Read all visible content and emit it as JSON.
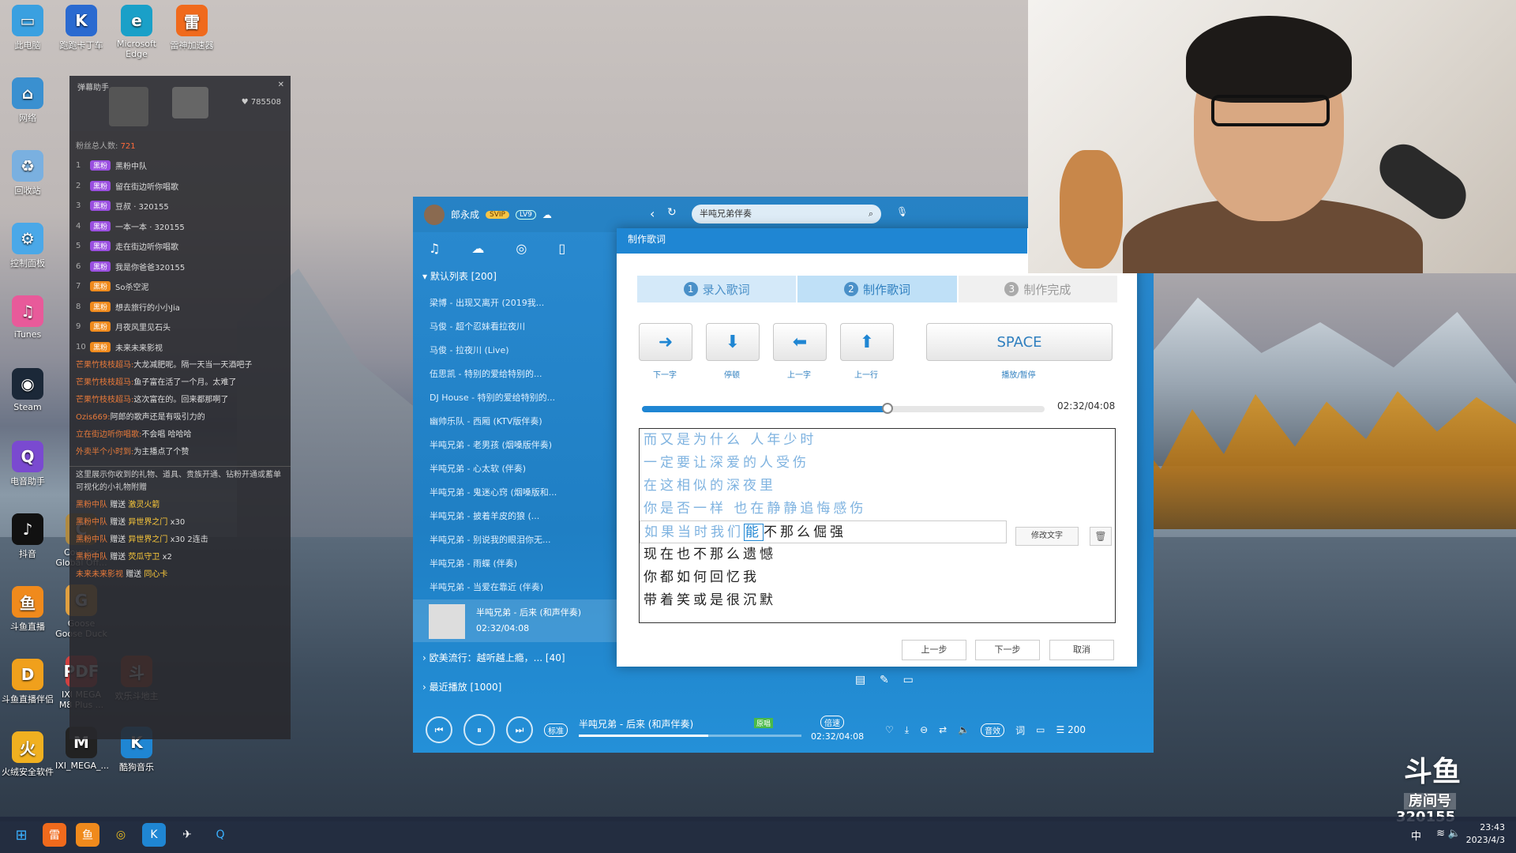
{
  "desktop": {
    "icons": [
      {
        "label": "此电脑",
        "glyph": "▭",
        "color": "#3aa0e0"
      },
      {
        "label": "网络",
        "glyph": "⌂",
        "color": "#3a90d0"
      },
      {
        "label": "回收站",
        "glyph": "♻",
        "color": "#7ab0e0"
      },
      {
        "label": "控制面板",
        "glyph": "⚙",
        "color": "#4aa8e8"
      },
      {
        "label": "iTunes",
        "glyph": "♫",
        "color": "#e85a9a"
      },
      {
        "label": "Steam",
        "glyph": "◉",
        "color": "#1b2838"
      },
      {
        "label": "电音助手",
        "glyph": "Q",
        "color": "#7a4ad0"
      },
      {
        "label": "抖音",
        "glyph": "♪",
        "color": "#111"
      },
      {
        "label": "斗鱼直播",
        "glyph": "鱼",
        "color": "#f08a1c"
      },
      {
        "label": "斗鱼直播伴侣",
        "glyph": "D",
        "color": "#f0a01c"
      },
      {
        "label": "火绒安全软件",
        "glyph": "火",
        "color": "#f0b020"
      }
    ],
    "icons_col2": [
      {
        "label": "跑跑卡丁车",
        "glyph": "K",
        "color": "#2a6ad0"
      },
      {
        "label": "Microsoft Edge",
        "glyph": "e",
        "color": "#1aa0c8"
      },
      {
        "label": "雷神加速器",
        "glyph": "雷",
        "color": "#f06a1c"
      },
      {
        "label": "IXI MEGA M8 Plus ...",
        "glyph": "PDF",
        "color": "#d04040"
      },
      {
        "label": "欢乐斗地主",
        "glyph": "斗",
        "color": "#c04a2a"
      },
      {
        "label": "IXI_MEGA_...",
        "glyph": "M",
        "color": "#222"
      },
      {
        "label": "酷狗音乐",
        "glyph": "K",
        "color": "#1f86d3"
      },
      {
        "label": "Counter Global Off...",
        "glyph": "C",
        "color": "#b08a40"
      },
      {
        "label": "Goose Goose Duck",
        "glyph": "G",
        "color": "#e0a040"
      }
    ]
  },
  "chat": {
    "title": "弹幕助手",
    "stat": "785508",
    "fans_label": "粉丝总人数:",
    "fans_count": "721",
    "badge": "黑粉",
    "ranks": [
      {
        "no": "1",
        "name": "黑粉中队"
      },
      {
        "no": "2",
        "name": "留在街边听你唱歌"
      },
      {
        "no": "3",
        "name": "豆叔 · 320155"
      },
      {
        "no": "4",
        "name": "一本一本 · 320155"
      },
      {
        "no": "5",
        "name": "走在街边听你唱歌"
      },
      {
        "no": "6",
        "name": "我是你爸爸320155"
      },
      {
        "no": "7",
        "name": "So杀空泥"
      },
      {
        "no": "8",
        "name": "想去旅行的小小Jia"
      },
      {
        "no": "9",
        "name": "月夜风里见石头"
      },
      {
        "no": "10",
        "name": "未来未来影视"
      }
    ],
    "messages": [
      {
        "who": "芒果竹枝枝超马:",
        "text": "大龙减肥呢。隔一天当一天酒吧子"
      },
      {
        "who": "芒果竹枝枝超马:",
        "text": "鱼子富在活了一个月。太难了"
      },
      {
        "who": "芒果竹枝枝超马:",
        "text": "这次富在的。回来都那啊了"
      },
      {
        "who": "Ozis669:",
        "text": "阿郎的歌声还是有吸引力的"
      },
      {
        "who": "立在街边听你唱歌:",
        "text": "不会唱 哈哈哈"
      },
      {
        "who": "外卖半个小时到:",
        "text": "为主播点了个赞"
      }
    ],
    "notice": "这里展示你收到的礼物、道具、贵族开通、钻粉开通或蓄单可视化的小礼物附赠",
    "gifts": [
      {
        "who": "黑粉中队",
        "verb": "赠送",
        "item": "激灵火箭",
        "count": ""
      },
      {
        "who": "黑粉中队",
        "verb": "赠送",
        "item": "异世界之门",
        "count": "x30"
      },
      {
        "who": "黑粉中队",
        "verb": "赠送",
        "item": "异世界之门",
        "count": "x30 2连击"
      },
      {
        "who": "黑粉中队",
        "verb": "赠送",
        "item": "荧瓜守卫",
        "count": "x2"
      },
      {
        "who": "未来未来影视",
        "verb": "赠送",
        "item": "同心卡",
        "count": ""
      }
    ]
  },
  "player": {
    "username": "郎永成",
    "svip": "SVIP",
    "level": "LV9",
    "search_value": "半吨兄弟伴奏",
    "nav_icons": [
      "music-icon",
      "cloud-icon",
      "radio-icon",
      "device-icon"
    ],
    "playlist_header": "默认列表 [200]",
    "songs": [
      "梁博 - 出现又离开 (2019我...",
      "马俊 - 超个忍妹看拉夜川",
      "马俊 - 拉夜川 (Live)",
      "伍思凯 - 特别的爱给特别的...",
      "DJ House - 特别的爱给特别的...",
      "幽帅乐队 - 西厢 (KTV版伴奏)",
      "半吨兄弟 - 老男孩 (烟嗓版伴奏)",
      "半吨兄弟 - 心太软 (伴奏)",
      "半吨兄弟 - 鬼迷心窍 (烟嗓版和...",
      "半吨兄弟 - 披着羊皮的狼 (...",
      "半吨兄弟 - 别说我的眼泪你无...",
      "半吨兄弟 - 雨蝶 (伴奏)",
      "半吨兄弟 - 当爱在靠近 (伴奏)"
    ],
    "now_playing_title": "半吨兄弟 - 后来 (和声伴奏)",
    "now_playing_time": "02:32/04:08",
    "group2": "欧美流行：越听越上瘾，... [40]",
    "group3": "最近播放 [1000]",
    "bottom": {
      "quality": "标准",
      "title": "半吨兄弟 - 后来 (和声伴奏)",
      "tag": "原唱",
      "speed": "倍速",
      "time": "02:32/04:08",
      "sound": "音效",
      "lyric_btn": "词",
      "count": "200"
    }
  },
  "dialog": {
    "title": "制作歌词",
    "steps": [
      {
        "no": "1",
        "label": "录入歌词"
      },
      {
        "no": "2",
        "label": "制作歌词"
      },
      {
        "no": "3",
        "label": "制作完成"
      }
    ],
    "keys": [
      {
        "glyph": "➜",
        "label": "下一字",
        "icon": "arrow-right-icon"
      },
      {
        "glyph": "⬇",
        "label": "停顿",
        "icon": "arrow-down-icon"
      },
      {
        "glyph": "⬅",
        "label": "上一字",
        "icon": "arrow-left-icon"
      },
      {
        "glyph": "⬆",
        "label": "上一行",
        "icon": "arrow-up-icon"
      }
    ],
    "space_label": "SPACE",
    "space_caption": "播放/暂停",
    "progress": 0.61,
    "time": "02:32/04:08",
    "lyrics_done": [
      "而又是为什么 人年少时",
      "一定要让深爱的人受伤",
      "在这相似的深夜里",
      "你是否一样 也在静静追悔感伤"
    ],
    "current_line_before": "如果当时我们",
    "current_char": "能",
    "current_line_after": "不那么倔强",
    "lyrics_pending": [
      "现在也不那么遗憾",
      "你都如何回忆我",
      "带着笑或是很沉默"
    ],
    "edit_text": "修改文字",
    "prev": "上一步",
    "next": "下一步",
    "cancel": "取消"
  },
  "watermark": {
    "brand": "斗鱼",
    "room_label": "房间号",
    "room_no": "320155"
  },
  "taskbar": {
    "time": "23:43",
    "date": "2023/4/3",
    "ime": "中"
  }
}
